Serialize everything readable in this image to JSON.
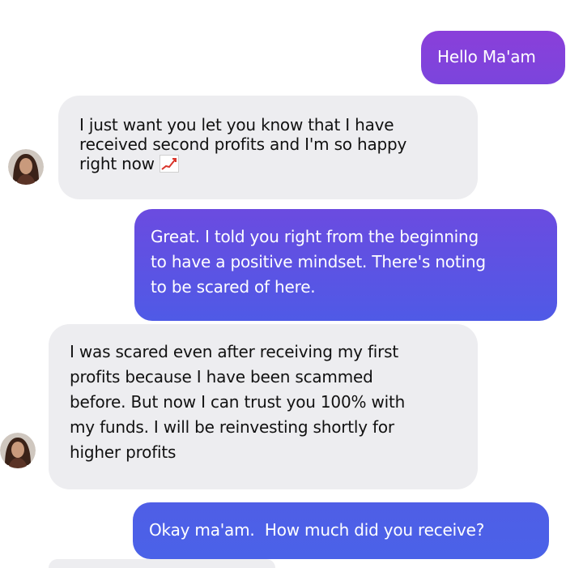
{
  "conversation": {
    "messages": [
      {
        "side": "sent",
        "text": "Hello Ma'am"
      },
      {
        "side": "received",
        "line1": "I just want you let you know that I have",
        "line2": "received second profits and I'm so happy",
        "line3": "right now",
        "icon": "chart-increasing-icon"
      },
      {
        "side": "sent",
        "line1": "Great. I told you right from the beginning",
        "line2": "to have a positive mindset. There's noting",
        "line3": "to be scared of here."
      },
      {
        "side": "received",
        "line1": "I was scared even after receiving my first",
        "line2": "profits because I have been scammed",
        "line3": "before. But now I can trust you 100% with",
        "line4": "my funds. I will be reinvesting shortly for",
        "line5": "higher profits"
      },
      {
        "side": "sent",
        "text": "Okay ma'am.  How much did you receive?"
      }
    ]
  },
  "colors": {
    "sent_gradient_top": "#8b3fd9",
    "sent_gradient_bottom": "#4a5de6",
    "received_bubble": "#ededf0",
    "chart_line": "#d9342b"
  }
}
